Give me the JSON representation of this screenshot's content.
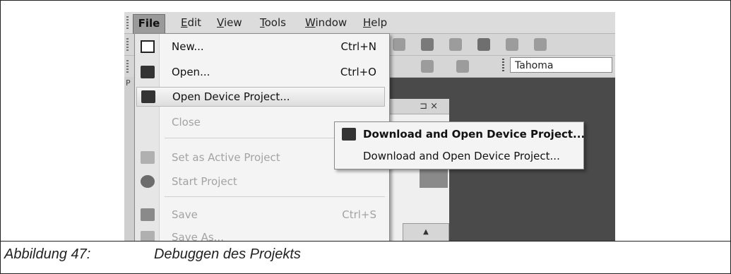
{
  "menubar": {
    "items": [
      {
        "label": "File"
      },
      {
        "label": "Edit"
      },
      {
        "label": "View"
      },
      {
        "label": "Tools"
      },
      {
        "label": "Window"
      },
      {
        "label": "Help"
      }
    ]
  },
  "toolbar": {
    "font_name": "Tahoma"
  },
  "panels": {
    "left_tab_initial": "P",
    "mid_panel_buttons": "⊐ ×"
  },
  "file_menu": {
    "items": [
      {
        "label": "New...",
        "shortcut": "Ctrl+N",
        "icon": "new-document-icon"
      },
      {
        "label": "Open...",
        "shortcut": "Ctrl+O",
        "icon": "open-folder-icon"
      },
      {
        "label": "Open Device Project...",
        "shortcut": "",
        "icon": "device-project-icon"
      },
      {
        "label": "Close",
        "shortcut": "",
        "icon": ""
      },
      {
        "label": "Set as Active Project",
        "shortcut": "",
        "icon": "active-project-icon"
      },
      {
        "label": "Start Project",
        "shortcut": "",
        "icon": "play-icon"
      },
      {
        "label": "Save",
        "shortcut": "Ctrl+S",
        "icon": "save-icon"
      },
      {
        "label": "Save As...",
        "shortcut": "",
        "icon": "save-as-icon"
      }
    ]
  },
  "submenu": {
    "items": [
      {
        "label": "Download and Open Device Project...",
        "icon": "device-project-icon"
      },
      {
        "label": "Download and Open Device Project...",
        "icon": ""
      }
    ]
  },
  "caption": {
    "number": "Abbildung 47:",
    "text": "Debuggen des Projekts"
  }
}
